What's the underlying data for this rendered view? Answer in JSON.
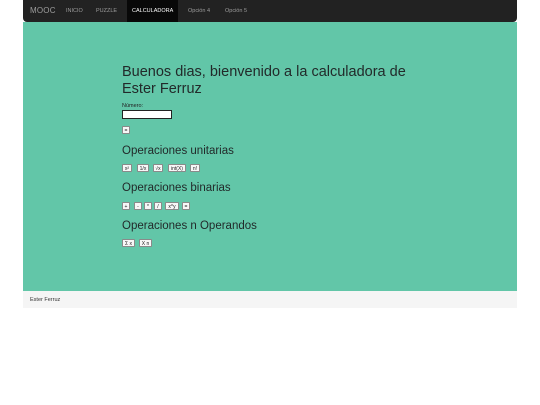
{
  "navbar": {
    "brand": "MOOC",
    "items": [
      {
        "label": "INICIO",
        "active": false
      },
      {
        "label": "PUZZLE",
        "active": false
      },
      {
        "label": "CALCULADORA",
        "active": true
      },
      {
        "label": "Opción 4",
        "active": false
      },
      {
        "label": "Opción 5",
        "active": false
      }
    ]
  },
  "main": {
    "title": "Buenos dias, bienvenido a la calculadora de Ester Ferruz",
    "number_label": "Número:",
    "number_value": "",
    "equals_label": "=",
    "unary": {
      "title": "Operaciones unitarias",
      "buttons": [
        "x²",
        "1/x",
        "√x",
        "int(X)",
        "n!"
      ]
    },
    "binary": {
      "title": "Operaciones binarias",
      "buttons": [
        "+",
        "-",
        "*",
        "/",
        "x^y",
        "="
      ]
    },
    "nary": {
      "title": "Operaciones n Operandos",
      "buttons": [
        "Σ x",
        "X n"
      ]
    }
  },
  "footer": {
    "text": "Ester Ferruz"
  },
  "colors": {
    "navbar_bg": "#222222",
    "main_bg": "#62c6a8",
    "footer_bg": "#f5f5f5"
  }
}
